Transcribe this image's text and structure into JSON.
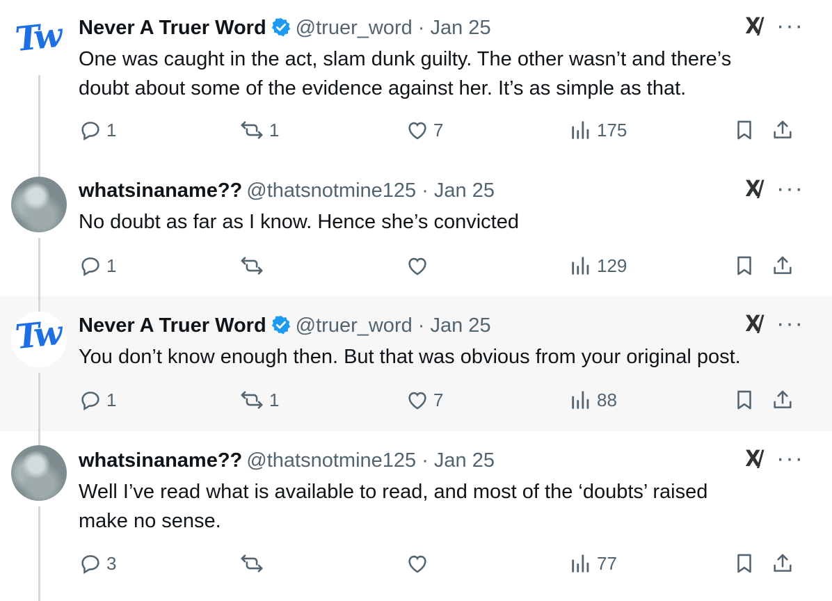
{
  "tweets": [
    {
      "name": "Never A Truer Word",
      "verified": true,
      "meta": "@truer_word · Jan 25",
      "avatar": "tw-logo",
      "avatar_text": "Tw",
      "lines": [
        "One was caught in the act, slam dunk guilty. The other wasn’t and there’s",
        "doubt about some of the evidence against her. It’s as simple as that."
      ],
      "replies": "1",
      "reposts": "1",
      "likes": "7",
      "views": "175",
      "highlighted": false
    },
    {
      "name": "whatsinaname??",
      "verified": false,
      "meta": "@thatsnotmine125 · Jan 25",
      "avatar": "photo",
      "lines": [
        "No doubt as far as I know. Hence she’s convicted"
      ],
      "replies": "1",
      "reposts": "",
      "likes": "",
      "views": "129",
      "highlighted": false
    },
    {
      "name": "Never A Truer Word",
      "verified": true,
      "meta": "@truer_word · Jan 25",
      "avatar": "tw-logo",
      "avatar_text": "Tw",
      "lines": [
        "You don’t know enough then. But that was obvious from your original post."
      ],
      "replies": "1",
      "reposts": "1",
      "likes": "7",
      "views": "88",
      "highlighted": true
    },
    {
      "name": "whatsinaname??",
      "verified": false,
      "meta": "@thatsnotmine125 · Jan 25",
      "avatar": "photo",
      "lines": [
        "Well I’ve read what is available to read, and most of the ‘doubts’ raised",
        "make no sense."
      ],
      "replies": "3",
      "reposts": "",
      "likes": "",
      "views": "77",
      "highlighted": false
    }
  ],
  "icons": {
    "grok": "grok-icon",
    "more": "more-icon",
    "reply": "reply-icon",
    "repost": "repost-icon",
    "like": "like-icon",
    "views": "views-icon",
    "bookmark": "bookmark-icon",
    "share": "share-icon",
    "verified": "verified-badge-icon"
  },
  "colors": {
    "verified": "#1d9bf0",
    "muted": "#536471",
    "highlight_bg": "#f7f7f7",
    "thread_line": "#cfd9de",
    "logo": "#1d6fe3"
  },
  "labels": {
    "grok_glyph": "X/",
    "more_glyph": "···"
  }
}
